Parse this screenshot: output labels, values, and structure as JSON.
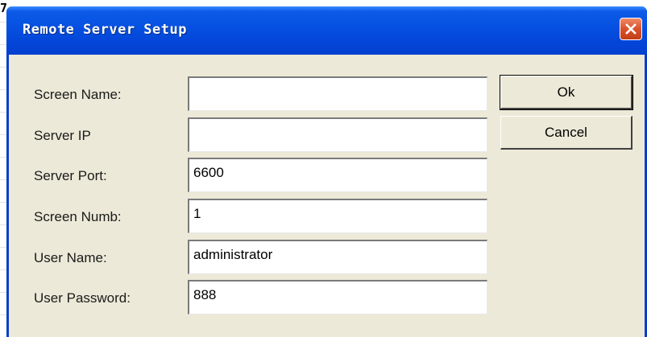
{
  "background": {
    "glyph": "7"
  },
  "window": {
    "title": "Remote Server Setup",
    "close_icon": "close-icon",
    "colors": {
      "title_bar": "#0550e0",
      "close_button": "#d8532b",
      "client": "#ece9d8"
    }
  },
  "form": {
    "fields": [
      {
        "label": "Screen Name:",
        "value": ""
      },
      {
        "label": "Server IP",
        "value": ""
      },
      {
        "label": "Server Port:",
        "value": "6600"
      },
      {
        "label": "Screen Numb:",
        "value": "1"
      },
      {
        "label": "User Name:",
        "value": "administrator"
      },
      {
        "label": "User Password:",
        "value": "888"
      }
    ]
  },
  "buttons": {
    "ok": "Ok",
    "cancel": "Cancel"
  }
}
